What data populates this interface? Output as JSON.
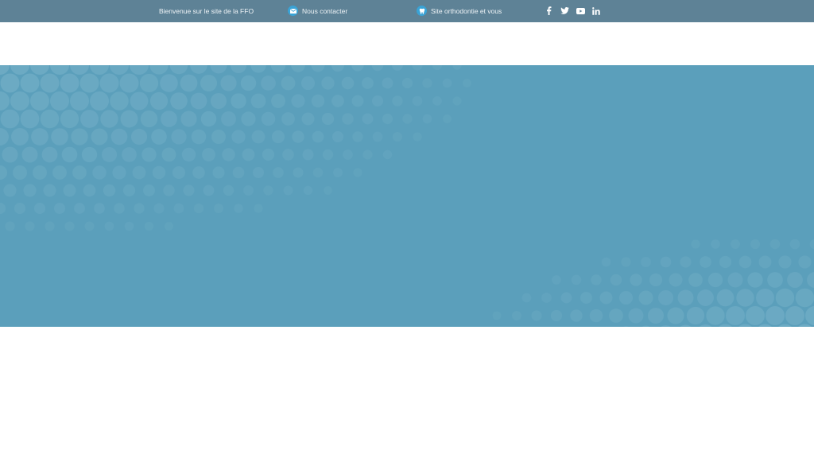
{
  "topbar": {
    "welcome_text": "Bienvenue sur le site de la FFO",
    "contact_label": "Nous contacter",
    "contact_icon": "envelope-icon",
    "site_label": "Site orthodontie et vous",
    "site_icon": "tooth-icon",
    "socials": [
      "facebook-icon",
      "twitter-icon",
      "youtube-icon",
      "linkedin-icon"
    ]
  },
  "colors": {
    "topbar_bg": "#5e8296",
    "icon_circle": "#3aa3d6",
    "hero_bg": "#5b9fbb",
    "hero_dots": "#7fb6cc"
  }
}
